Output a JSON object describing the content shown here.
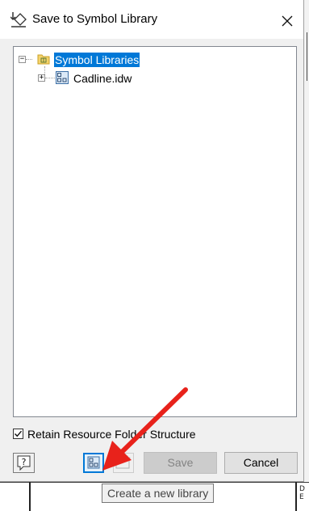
{
  "window": {
    "title": "Save to Symbol Library"
  },
  "tree": {
    "items": [
      {
        "label": "Symbol Libraries",
        "expander": "−",
        "icon": "folder-icon",
        "selected": true
      },
      {
        "label": "Cadline.idw",
        "expander": "+",
        "icon": "library-icon",
        "selected": false
      }
    ]
  },
  "options": {
    "retain_label": "Retain Resource Folder Structure",
    "retain_checked": true
  },
  "buttons": {
    "save": "Save",
    "cancel": "Cancel",
    "help_icon": "help-icon",
    "new_library_icon": "new-library-icon",
    "new_folder_icon": "new-folder-icon"
  },
  "tooltip": {
    "text": "Create a new library"
  },
  "background": {
    "fragment_text": "D\nE"
  },
  "colors": {
    "selection": "#0078d7",
    "annotation_arrow": "#e8221b",
    "folder": "#f5d36c"
  }
}
